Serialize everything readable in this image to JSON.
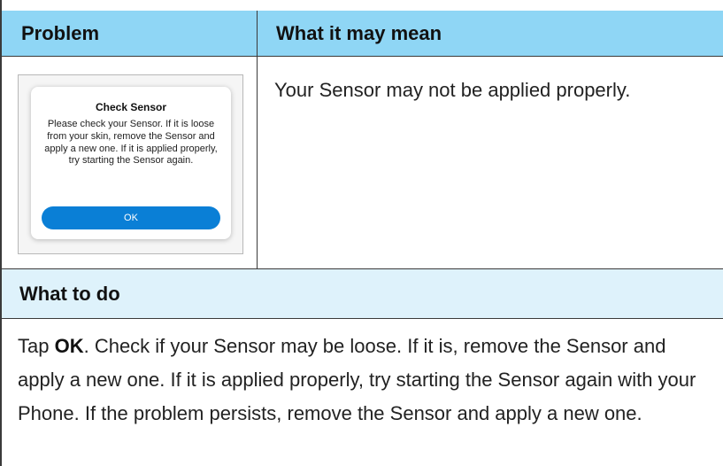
{
  "table": {
    "header": {
      "problem_label": "Problem",
      "meaning_label": "What it may mean"
    },
    "problem_screen": {
      "dialog_title": "Check Sensor",
      "dialog_message": "Please check your Sensor. If it is loose from your skin, remove the Sensor and apply a new one. If it is applied properly, try starting the Sensor again.",
      "ok_button_label": "OK"
    },
    "meaning_text": "Your Sensor may not be applied properly.",
    "todo": {
      "header_label": "What to do",
      "tap_prefix": "Tap ",
      "tap_target": "OK",
      "instructions": ". Check if your Sensor may be loose. If it is, remove the Sensor and apply a new one. If it is applied properly, try starting the Sensor again with your Phone. If the problem persists, remove the Sensor and apply a new one."
    }
  },
  "colors": {
    "header_bg": "#8fd6f5",
    "todo_header_bg": "#def2fb",
    "ok_button_bg": "#0a7fd6"
  }
}
